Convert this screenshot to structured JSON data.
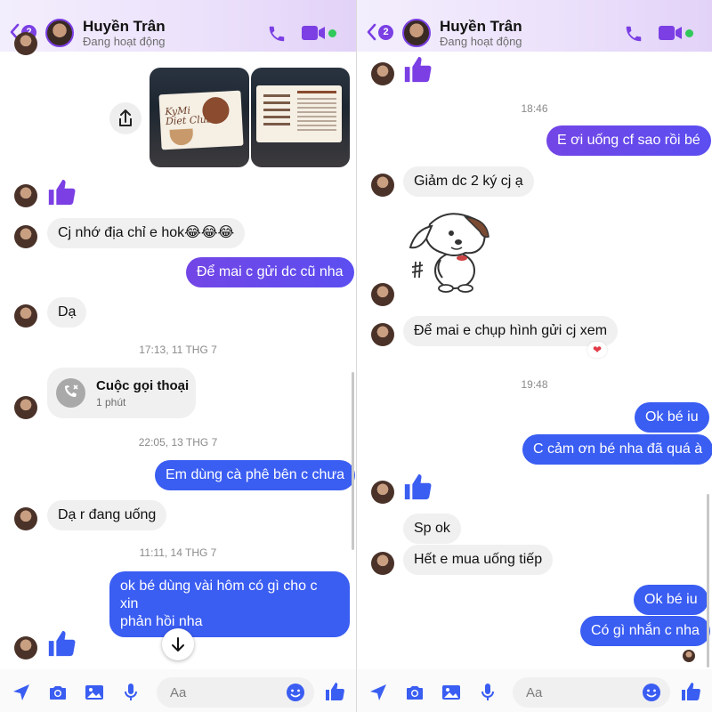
{
  "contact": {
    "name": "Huyền Trân",
    "status": "Đang hoạt động",
    "unread_badge": "2"
  },
  "colors": {
    "accent": "#7b3fe4",
    "outgoing_bubble": "#5b4ef0",
    "incoming_bubble": "#f0f0f0",
    "online": "#31c95a"
  },
  "left": {
    "messages": {
      "m1": "Cj nhớ địa chỉ e hok😂😂😂",
      "m2": "Để mai c gửi dc cũ nha",
      "m3": "Dạ",
      "m4": "Em dùng cà phê bên c chưa",
      "m5": "Dạ r đang uống",
      "m6_line1": "ok bé dùng vài hôm có gì cho c xin",
      "m6_line2": "phản hồi nha"
    },
    "timestamps": {
      "t1": "17:13, 11 THG 7",
      "t2": "22:05, 13 THG 7",
      "t3": "11:11, 14 THG 7"
    },
    "call": {
      "title": "Cuộc gọi thoại",
      "duration": "1 phút"
    },
    "photo": {
      "card_title_line1": "KyMi",
      "card_title_line2": "Diet Club"
    }
  },
  "right": {
    "messages": {
      "m1": "E ơi uống cf sao rồi bé",
      "m2": "Giảm dc 2 ký cj ạ",
      "m3": "Để mai e chụp hình gửi cj xem",
      "m4": "Ok bé iu",
      "m5": "C cảm ơn bé nha đã quá à",
      "m6": "Sp ok",
      "m7": "Hết e mua uống tiếp",
      "m8": "Ok bé iu",
      "m9": "Có gì nhắn c nha"
    },
    "timestamps": {
      "t1": "18:46",
      "t2": "19:48"
    },
    "reaction": "heart"
  },
  "composer": {
    "placeholder": "Aa"
  },
  "icons": [
    "back-chevron-icon",
    "phone-icon",
    "video-icon",
    "share-icon",
    "thumbs-up-icon",
    "call-icon",
    "arrow-down-icon",
    "location-icon",
    "camera-icon",
    "gallery-icon",
    "microphone-icon",
    "emoji-icon",
    "like-icon"
  ]
}
